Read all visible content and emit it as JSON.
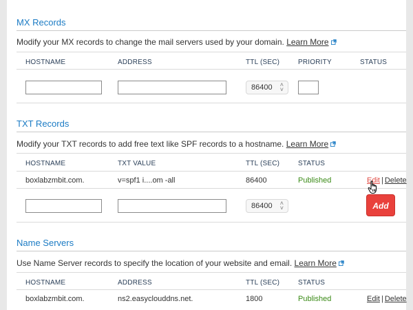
{
  "mx": {
    "title": "MX Records",
    "description": "Modify your MX records to change the mail servers used by your domain.",
    "learn_more": "Learn More",
    "columns": [
      "HOSTNAME",
      "ADDRESS",
      "TTL (SEC)",
      "PRIORITY",
      "STATUS"
    ],
    "new_row": {
      "hostname": "",
      "address": "",
      "ttl": "86400",
      "priority": ""
    }
  },
  "txt": {
    "title": "TXT Records",
    "description": "Modify your TXT records to add free text like SPF records to a hostname.",
    "learn_more": "Learn More",
    "columns": [
      "HOSTNAME",
      "TXT VALUE",
      "TTL (SEC)",
      "STATUS"
    ],
    "rows": [
      {
        "hostname": "boxlabzmbit.com.",
        "value": "v=spf1 i....om -all",
        "ttl": "86400",
        "status": "Published",
        "edit": "Edit",
        "separator": "|",
        "delete": "Delete"
      }
    ],
    "new_row": {
      "hostname": "",
      "value": "",
      "ttl": "86400",
      "add_label": "Add"
    }
  },
  "ns": {
    "title": "Name Servers",
    "description": "Use Name Server records to specify the location of your website and email.",
    "learn_more": "Learn More",
    "columns": [
      "HOSTNAME",
      "ADDRESS",
      "TTL (SEC)",
      "STATUS"
    ],
    "rows": [
      {
        "hostname": "boxlabzmbit.com.",
        "address": "ns2.easyclouddns.net.",
        "ttl": "1800",
        "status": "Published",
        "edit": "Edit",
        "separator": "|",
        "delete": "Delete"
      }
    ]
  },
  "icons": {
    "external": "external-link-icon",
    "chevron": "up-down-chevron-icon",
    "cursor": "hand-pointer-icon"
  },
  "colors": {
    "section_title": "#1b7bc4",
    "published": "#3a8a16",
    "add_button": "#e9413c",
    "edit_hover": "#e04d46"
  }
}
